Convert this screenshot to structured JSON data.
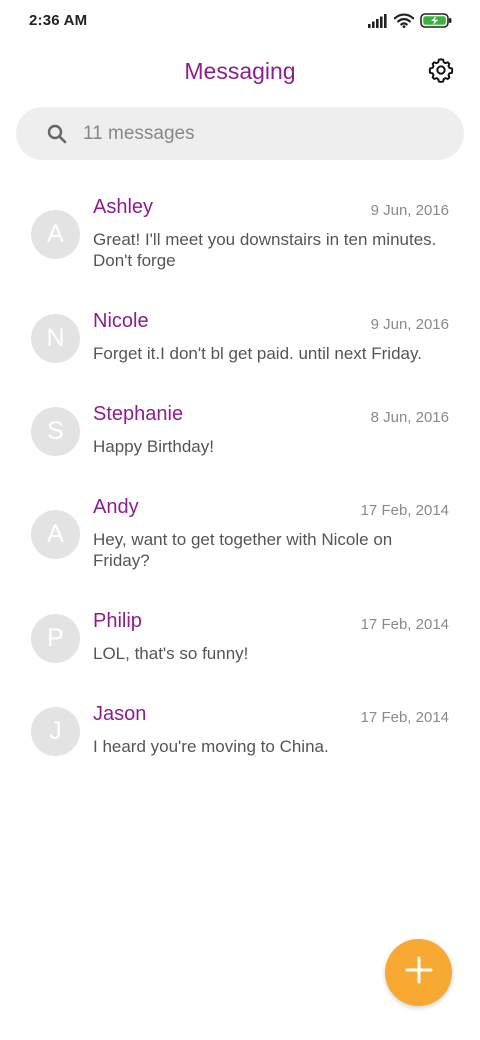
{
  "status_bar": {
    "time": "2:36 AM",
    "icons": [
      "signal-icon",
      "wifi-icon",
      "battery-charging-icon"
    ],
    "battery_color": "#3db33d"
  },
  "header": {
    "title": "Messaging",
    "settings_icon": "gear-icon"
  },
  "search": {
    "icon": "search-icon",
    "placeholder": "11 messages"
  },
  "conversations": [
    {
      "initial": "A",
      "name": "Ashley",
      "date": "9 Jun, 2016",
      "snippet": "Great! I'll meet you downstairs in ten minutes. Don't forge"
    },
    {
      "initial": "N",
      "name": "Nicole",
      "date": "9 Jun, 2016",
      "snippet": "Forget it.I don't bl get paid. until next Friday."
    },
    {
      "initial": "S",
      "name": "Stephanie",
      "date": "8 Jun, 2016",
      "snippet": "Happy Birthday!"
    },
    {
      "initial": "A",
      "name": "Andy",
      "date": "17 Feb, 2014",
      "snippet": "Hey, want to get together with Nicole on Friday?"
    },
    {
      "initial": "P",
      "name": "Philip",
      "date": "17 Feb, 2014",
      "snippet": "LOL, that's so funny!"
    },
    {
      "initial": "J",
      "name": "Jason",
      "date": "17 Feb, 2014",
      "snippet": "I heard you're moving to China."
    }
  ],
  "fab": {
    "icon": "plus-icon",
    "color": "#f7a934"
  },
  "colors": {
    "accent": "#8b1f8b",
    "avatar_bg": "#e3e3e3",
    "search_bg": "#eeeeee"
  }
}
